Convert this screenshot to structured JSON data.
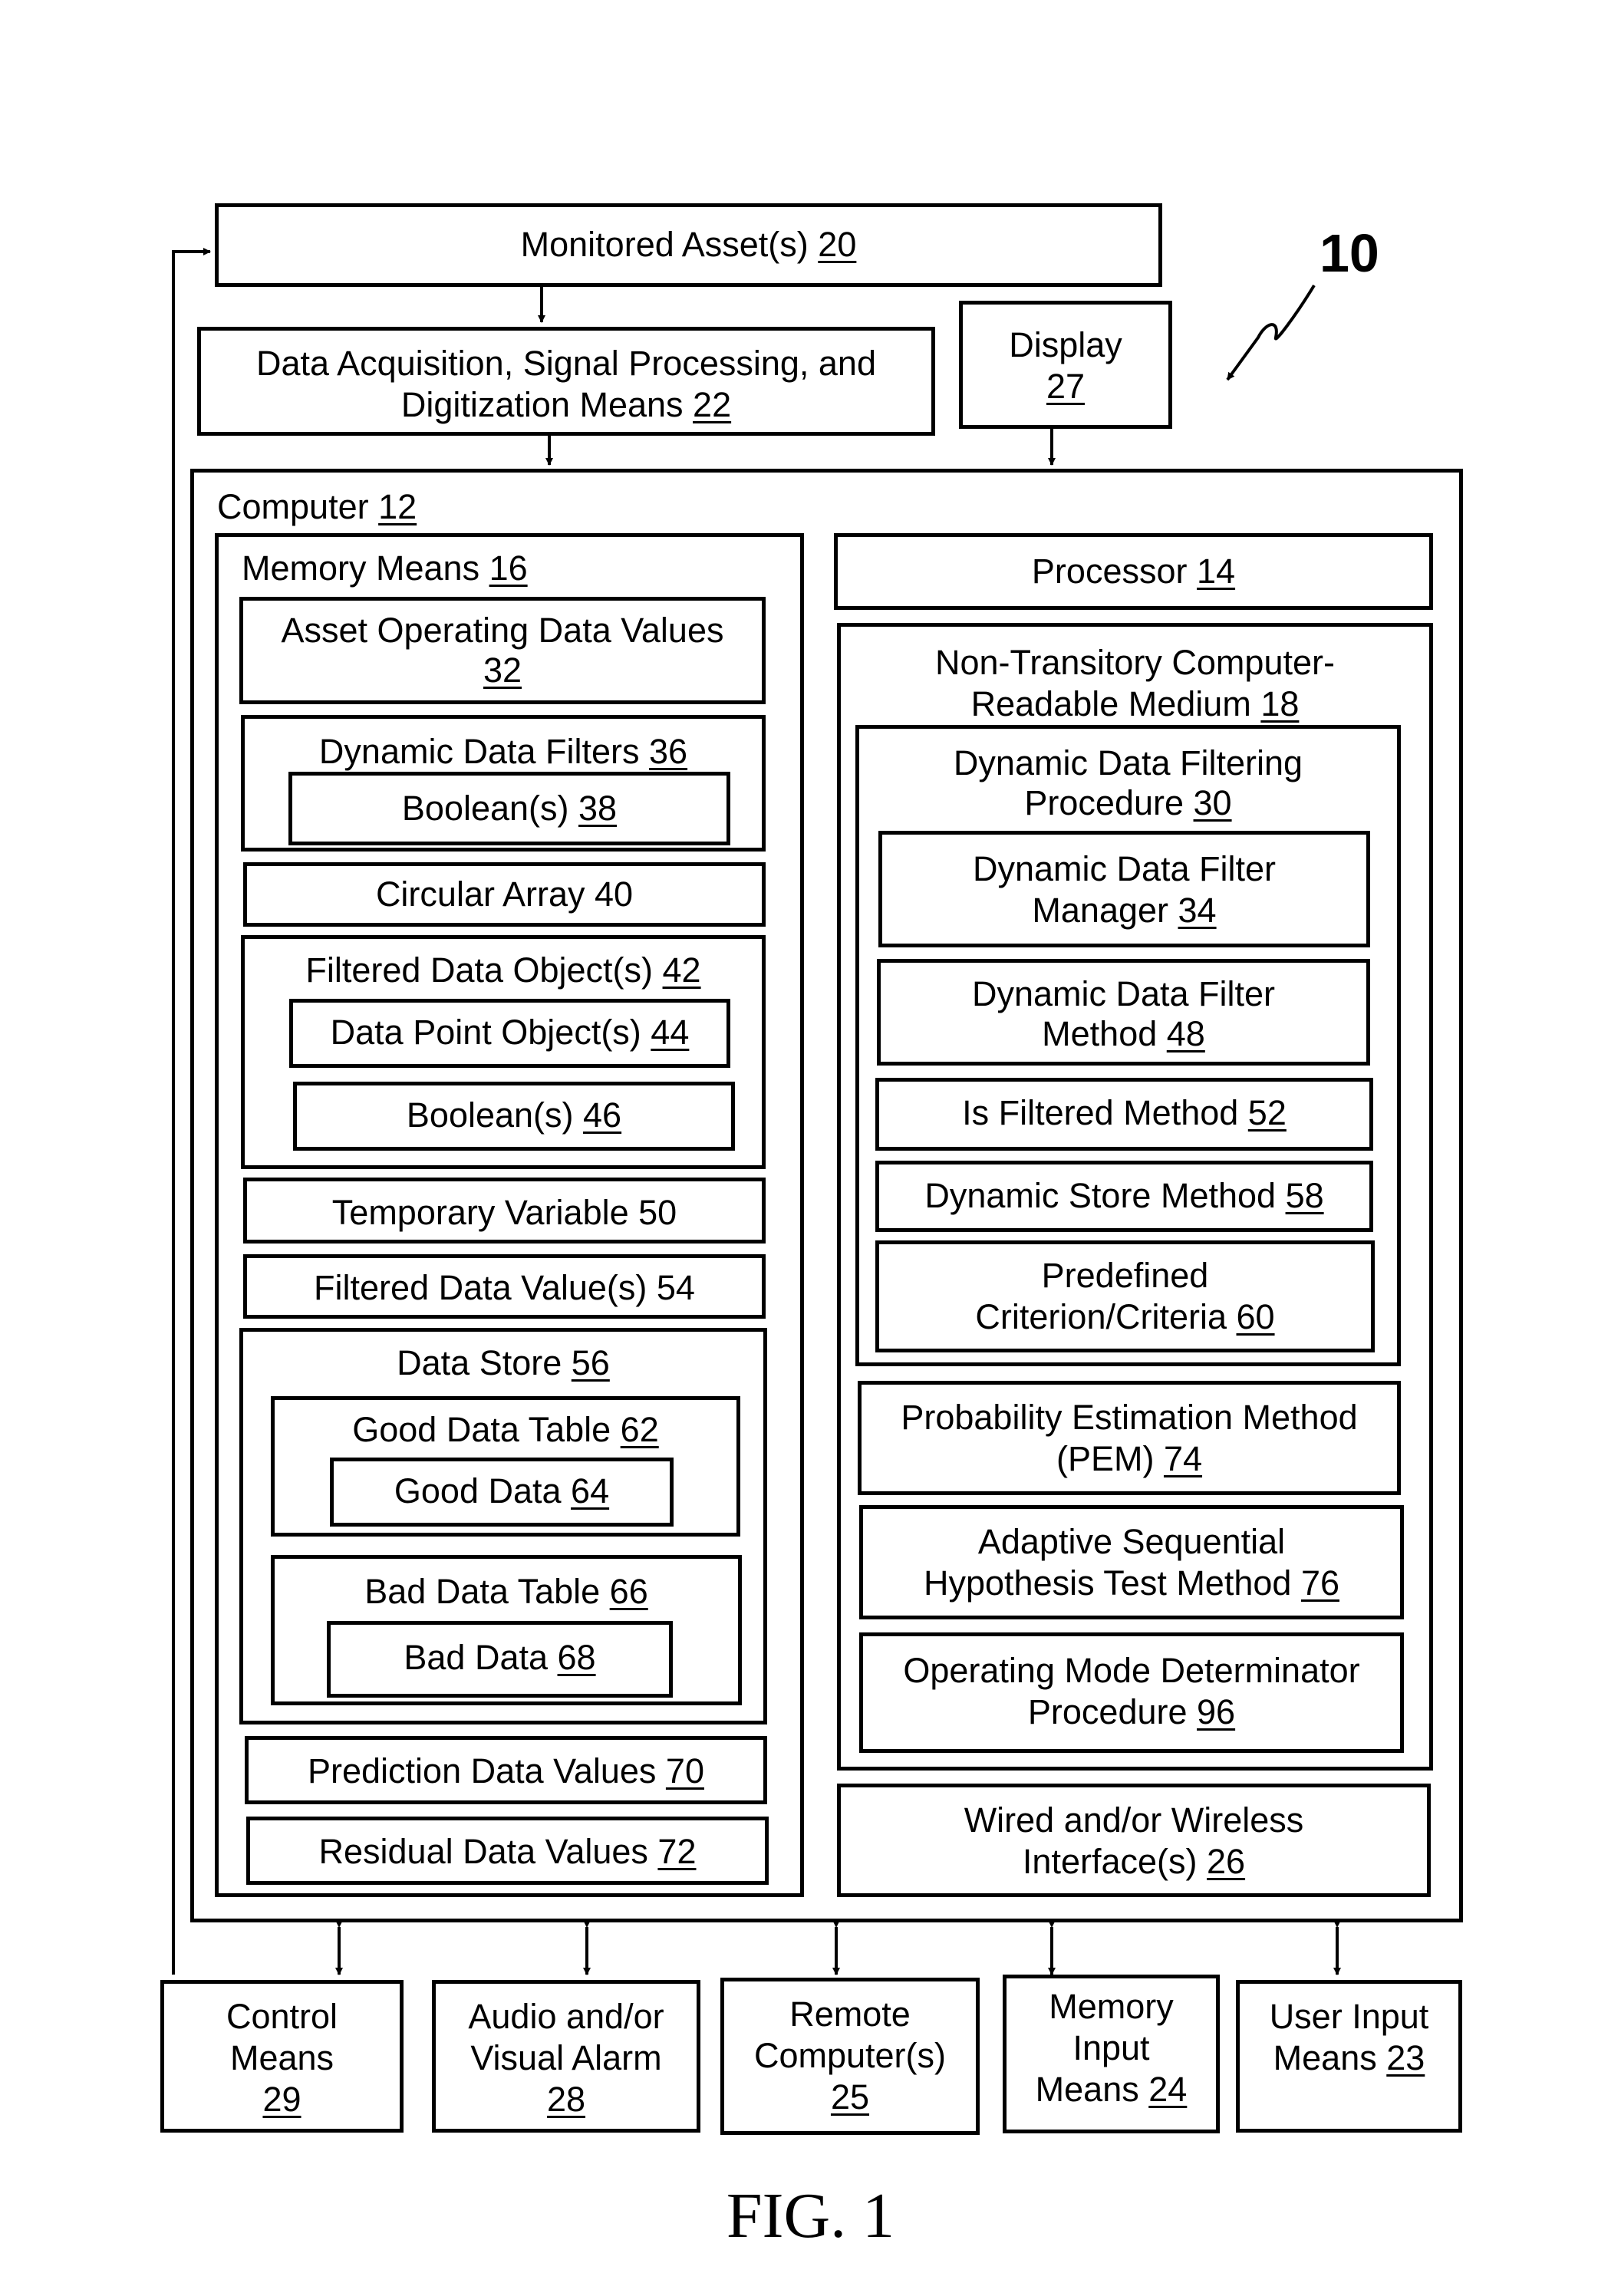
{
  "figure": {
    "caption": "FIG. 1",
    "system_ref": "10"
  },
  "boxes": {
    "monitored_asset": {
      "text": "Monitored Asset(s) ",
      "ref": "20"
    },
    "data_acquisition": {
      "line1": "Data Acquisition, Signal Processing, and",
      "line2": "Digitization Means ",
      "ref": "22"
    },
    "display": {
      "line1": "Display",
      "ref": "27"
    },
    "computer": {
      "text": "Computer ",
      "ref": "12"
    },
    "memory_means": {
      "text": "Memory Means ",
      "ref": "16"
    },
    "asset_operating_data": {
      "line1": "Asset Operating Data Values",
      "ref": "32"
    },
    "dynamic_data_filters": {
      "text": "Dynamic Data Filters ",
      "ref": "36"
    },
    "booleans_38": {
      "text": "Boolean(s) ",
      "ref": "38"
    },
    "circular_array": {
      "text": "Circular Array 40"
    },
    "filtered_data_objects": {
      "text": "Filtered Data Object(s) ",
      "ref": "42"
    },
    "data_point_objects": {
      "text": "Data Point Object(s) ",
      "ref": "44"
    },
    "booleans_46": {
      "text": "Boolean(s) ",
      "ref": "46"
    },
    "temporary_variable": {
      "text": "Temporary Variable 50"
    },
    "filtered_data_values": {
      "text": "Filtered Data Value(s) 54"
    },
    "data_store": {
      "text": "Data Store ",
      "ref": "56"
    },
    "good_data_table": {
      "text": "Good Data Table ",
      "ref": "62"
    },
    "good_data": {
      "text": "Good Data ",
      "ref": "64"
    },
    "bad_data_table": {
      "text": "Bad Data Table ",
      "ref": "66"
    },
    "bad_data": {
      "text": "Bad Data ",
      "ref": "68"
    },
    "prediction_data_values": {
      "text": "Prediction Data Values ",
      "ref": "70"
    },
    "residual_data_values": {
      "text": "Residual Data Values ",
      "ref": "72"
    },
    "processor": {
      "text": "Processor ",
      "ref": "14"
    },
    "ntcrm": {
      "line1": "Non-Transitory Computer-",
      "line2": "Readable Medium ",
      "ref": "18"
    },
    "ddf_procedure": {
      "line1": "Dynamic Data Filtering",
      "line2": "Procedure ",
      "ref": "30"
    },
    "ddf_manager": {
      "line1": "Dynamic Data Filter",
      "line2": "Manager ",
      "ref": "34"
    },
    "ddf_method": {
      "line1": "Dynamic Data Filter",
      "line2": "Method ",
      "ref": "48"
    },
    "is_filtered_method": {
      "text": "Is Filtered Method ",
      "ref": "52"
    },
    "dynamic_store_method": {
      "text": "Dynamic Store Method ",
      "ref": "58"
    },
    "predefined_criteria": {
      "line1": "Predefined",
      "line2": "Criterion/Criteria ",
      "ref": "60"
    },
    "pem": {
      "line1": "Probability Estimation Method",
      "line2": "(PEM) ",
      "ref": "74"
    },
    "asht": {
      "line1": "Adaptive Sequential",
      "line2": "Hypothesis Test Method ",
      "ref": "76"
    },
    "omd": {
      "line1": "Operating Mode Determinator",
      "line2": "Procedure ",
      "ref": "96"
    },
    "interfaces": {
      "line1": "Wired and/or Wireless",
      "line2": "Interface(s) ",
      "ref": "26"
    },
    "control_means": {
      "line1": "Control",
      "line2": "Means",
      "ref": "29"
    },
    "alarm": {
      "line1": "Audio and/or",
      "line2": "Visual Alarm",
      "ref": "28"
    },
    "remote_computers": {
      "line1": "Remote",
      "line2": "Computer(s)",
      "ref": "25"
    },
    "memory_input": {
      "line1": "Memory",
      "line2": "Input",
      "line3": "Means ",
      "ref": "24"
    },
    "user_input": {
      "line1": "User Input",
      "line2": "Means ",
      "ref": "23"
    }
  }
}
